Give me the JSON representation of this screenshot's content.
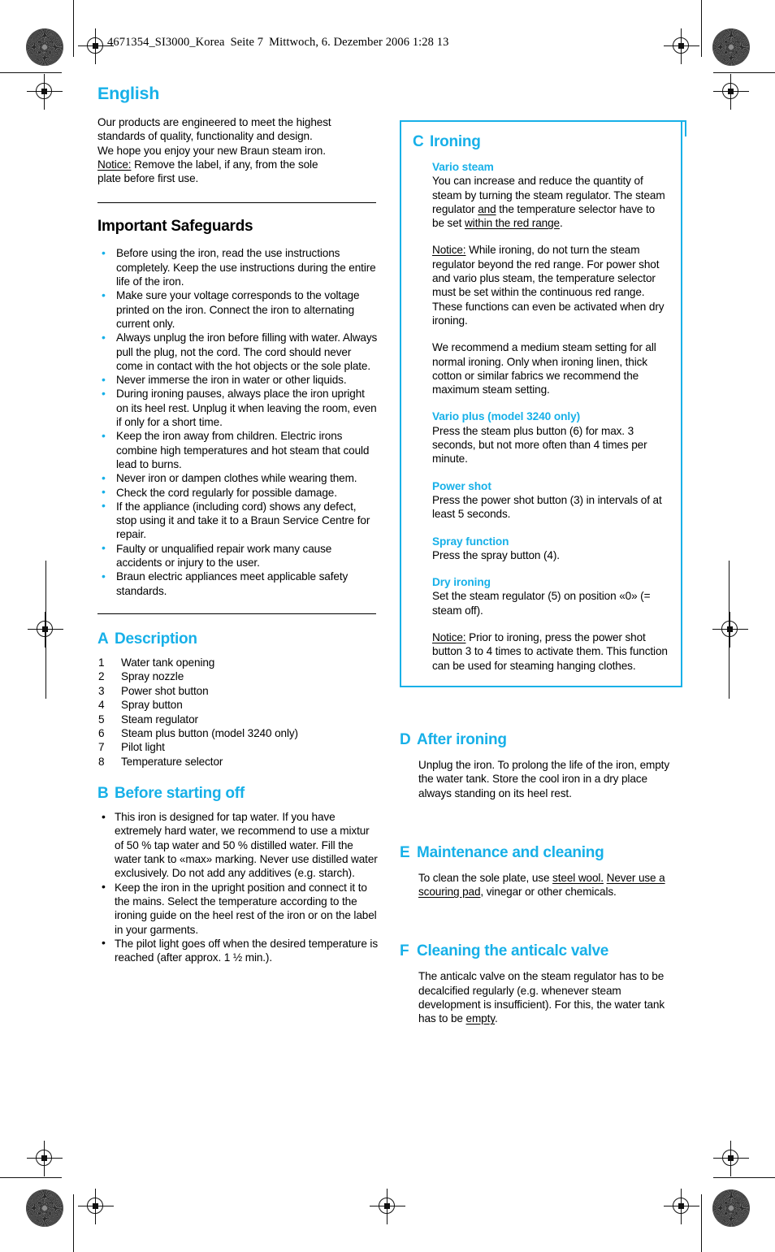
{
  "print_slug": {
    "filename": "4671354_SI3000_Korea",
    "page": "Seite 7",
    "datetime": "Mittwoch, 6. Dezember 2006  1:28 13"
  },
  "colors": {
    "accent_cyan": "#17b0e8",
    "text": "#000000",
    "background": "#ffffff"
  },
  "left_column": {
    "language_heading": "English",
    "intro": {
      "line1": "Our products are engineered to meet the highest",
      "line2": "standards of quality, functionality and design.",
      "line3": "We hope you enjoy your new Braun steam iron.",
      "notice_label": "Notice:",
      "notice_text": " Remove the label, if any, from the sole",
      "line5": "plate before first use."
    },
    "safeguards": {
      "heading": "Important Safeguards",
      "items": [
        "Before using the iron, read the use instructions completely. Keep the use instructions during the entire life of the iron.",
        "Make sure your voltage corresponds to the voltage printed on the iron. Connect the iron to alternating current only.",
        "Always unplug the iron before filling with water. Always pull the plug, not the cord. The cord should never come in contact with the hot objects or the sole plate.",
        "Never immerse the iron in water or other liquids.",
        "During ironing pauses, always place the iron upright on its heel rest. Unplug it when leaving the room, even if only for a short time.",
        "Keep the iron away from children. Electric irons combine high temperatures and hot steam that could lead to burns.",
        "Never iron or dampen clothes while wearing them.",
        "Check the cord regularly for possible damage.",
        "If the appliance (including cord) shows any defect, stop using it and take it to a Braun Service Centre for repair.",
        "Faulty or unqualified repair work many cause accidents or injury to the user.",
        "Braun electric appliances meet applicable safety standards."
      ]
    },
    "section_a": {
      "letter": "A",
      "title": "Description",
      "items": [
        {
          "num": "1",
          "label": "Water tank opening"
        },
        {
          "num": "2",
          "label": "Spray nozzle"
        },
        {
          "num": "3",
          "label": "Power shot button"
        },
        {
          "num": "4",
          "label": "Spray button"
        },
        {
          "num": "5",
          "label": "Steam regulator"
        },
        {
          "num": "6",
          "label": "Steam plus button (model 3240 only)"
        },
        {
          "num": "7",
          "label": "Pilot light"
        },
        {
          "num": "8",
          "label": "Temperature selector"
        }
      ]
    },
    "section_b": {
      "letter": "B",
      "title": "Before starting off",
      "items": [
        "This iron is designed for tap water. If you have extremely hard water, we recommend to use a mixtur of 50 % tap water and 50 % distilled water. Fill the water tank to «max» marking. Never use distilled water exclusively. Do not add any additives (e.g. starch).",
        "Keep the iron in the upright position and connect it to the mains. Select the temperature according to the ironing guide on the heel rest of the iron or on the label in your garments.",
        "The pilot light goes off when the desired temperature is reached (after approx. 1 ½ min.)."
      ]
    }
  },
  "right_column": {
    "section_c": {
      "letter": "C",
      "title": "Ironing",
      "vario_steam": {
        "heading": "Vario steam",
        "p1_a": "You can increase and reduce the quantity of steam by turning the steam regulator. The steam regulator ",
        "p1_u1": "and",
        "p1_b": " the temperature selector have to be set ",
        "p1_u2": "within the red range",
        "p1_c": ".",
        "notice_label": "Notice:",
        "notice_text": " While ironing, do not turn the steam regulator beyond the red range. For power shot and vario plus steam, the temperature selector must be set within the continuous red range.",
        "notice_text2": "These functions can even be activated when dry ironing.",
        "p3": "We recommend a medium steam setting for all normal ironing. Only when ironing linen, thick cotton or similar fabrics we recommend the maximum steam setting."
      },
      "vario_plus": {
        "heading": "Vario plus (model 3240 only)",
        "text": "Press the steam plus button (6) for max. 3 seconds, but not more often than 4 times per minute."
      },
      "power_shot": {
        "heading": "Power shot",
        "text": "Press the power shot button (3) in intervals of at least 5 seconds."
      },
      "spray_function": {
        "heading": "Spray function",
        "text": "Press the spray button (4)."
      },
      "dry_ironing": {
        "heading": "Dry ironing",
        "text": "Set the steam regulator (5) on position «0» (= steam off).",
        "notice_label": "Notice:",
        "notice_text": " Prior to ironing, press the power shot button 3 to 4 times to activate them. This function can be used for steaming hanging clothes."
      }
    },
    "section_d": {
      "letter": "D",
      "title": "After ironing",
      "text": "Unplug the iron. To prolong the life of the iron, empty the water tank. Store the cool iron in a dry place always standing on its heel rest."
    },
    "section_e": {
      "letter": "E",
      "title": "Maintenance and cleaning",
      "text_a": "To clean the sole plate, use ",
      "text_u1": "steel wool.",
      "text_b": " ",
      "text_u2": "Never use a scouring pad",
      "text_c": ", vinegar or other chemicals."
    },
    "section_f": {
      "letter": "F",
      "title": "Cleaning the anticalc valve",
      "text_a": "The anticalc valve on the steam regulator has to be decalcified regularly (e.g. whenever steam development is insufficient). For this, the water tank has to be ",
      "text_u": "empty",
      "text_b": "."
    }
  }
}
